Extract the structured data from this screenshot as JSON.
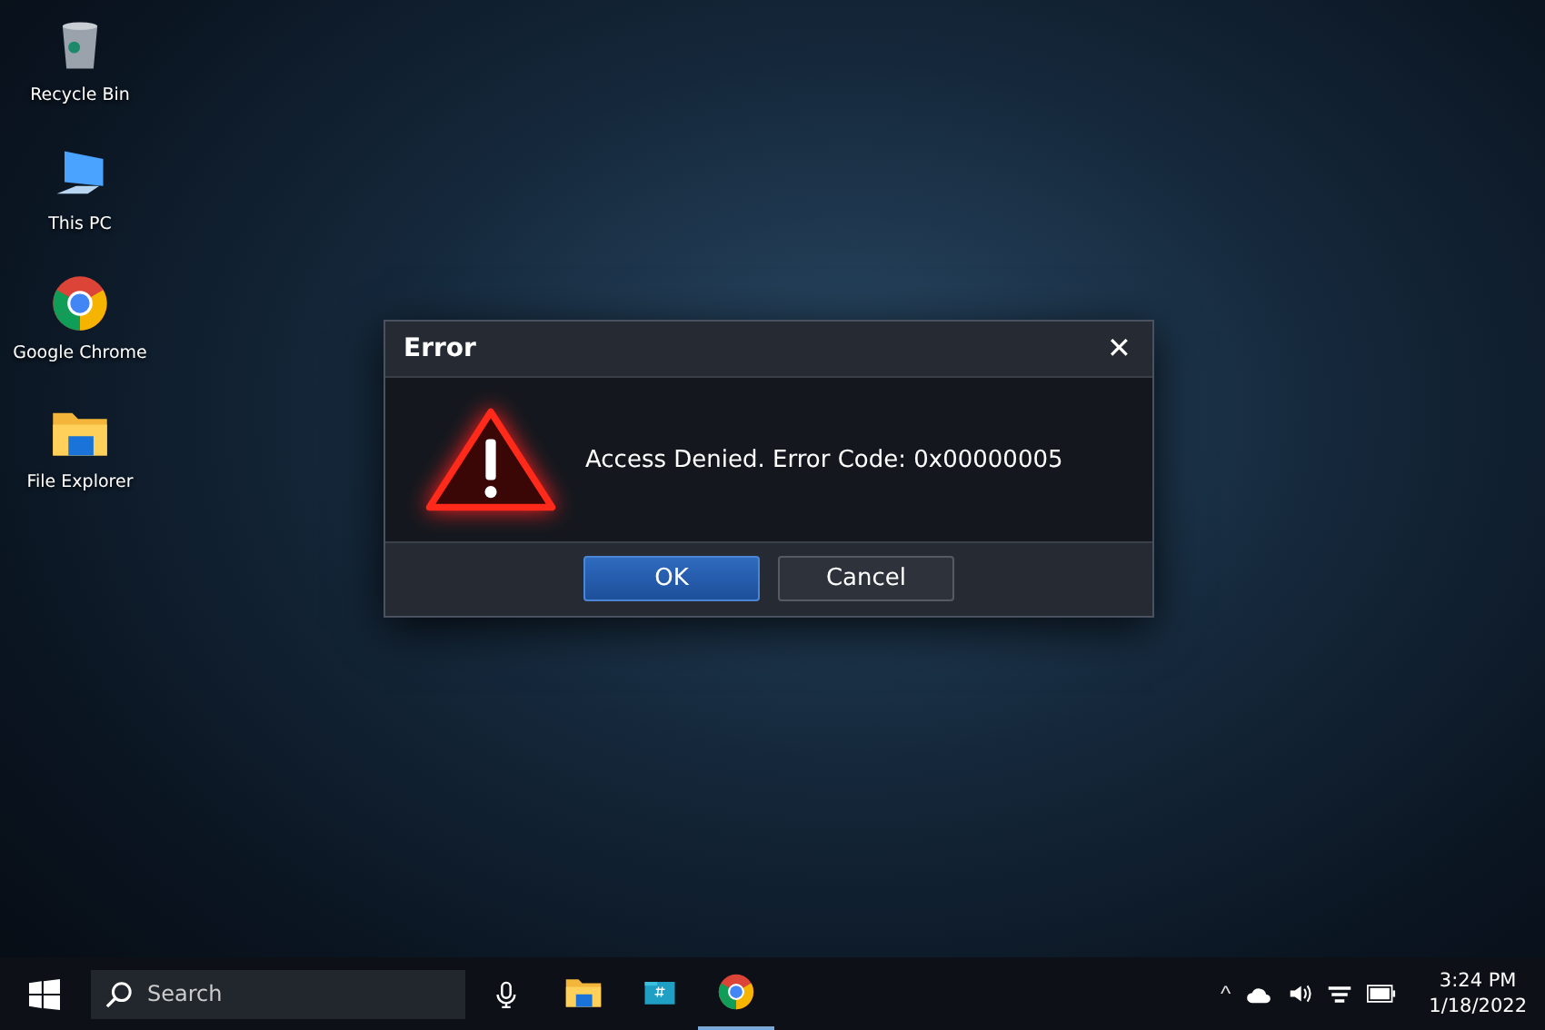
{
  "desktop_icons": [
    {
      "kind": "recycle",
      "label": "Recycle Bin"
    },
    {
      "kind": "pc",
      "label": "This PC"
    },
    {
      "kind": "chrome",
      "label": "Google Chrome"
    },
    {
      "kind": "folder",
      "label": "File Explorer"
    }
  ],
  "dialog": {
    "title": "Error",
    "close": "✕",
    "message": "Access Denied. Error Code: 0x00000005",
    "buttons": [
      {
        "label": "OK",
        "primary": true
      },
      {
        "label": "Cancel",
        "primary": false
      }
    ]
  },
  "taskbar": {
    "search": {
      "placeholder": "Search"
    },
    "apps": [
      {
        "kind": "folder",
        "selected": false
      },
      {
        "kind": "store",
        "selected": false
      },
      {
        "kind": "chrome",
        "selected": true
      }
    ],
    "tray": {
      "caret": "^"
    },
    "clock": {
      "time": "3:24 PM",
      "date": "1/18/2022"
    }
  }
}
